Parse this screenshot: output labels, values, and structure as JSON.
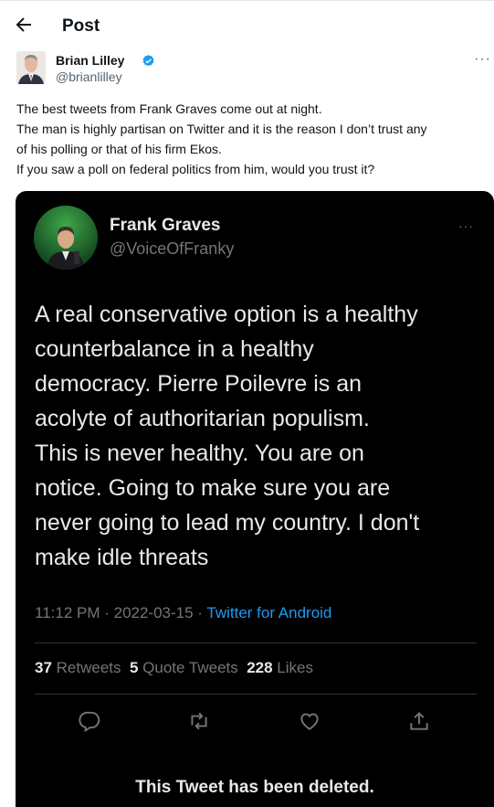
{
  "header": {
    "title": "Post",
    "back_icon": "back-arrow-icon"
  },
  "author": {
    "name": "Brian Lilley",
    "handle": "@brianlilley",
    "verified": true,
    "more_icon": "more-options-icon"
  },
  "post": {
    "lines": [
      "The best tweets from Frank Graves come out at night.",
      "The man is highly partisan on Twitter and it is the reason I don’t trust any",
      "of his polling or that of his firm Ekos.",
      "If you saw a poll on federal politics from him, would you trust it?"
    ]
  },
  "embedded_tweet": {
    "name": "Frank Graves",
    "handle": "@VoiceOfFranky",
    "lines": [
      "A real conservative option is a healthy",
      "counterbalance in a healthy",
      "democracy.  Pierre Poilevre is an",
      "acolyte of authoritarian populism.",
      "This is never healthy. You are on",
      "notice.  Going to make sure you are",
      "never going to lead my country. I don't",
      "make idle threats"
    ],
    "time": "11:12 PM · 2022-03-15 · ",
    "source": "Twitter for Android",
    "stats": {
      "retweets_count": "37",
      "retweets_label": " Retweets  ",
      "quotes_count": "5",
      "quotes_label": " Quote Tweets  ",
      "likes_count": "228",
      "likes_label": " Likes"
    },
    "actions": [
      "reply-icon",
      "retweet-icon",
      "like-icon",
      "share-icon"
    ],
    "deleted_notice": "This Tweet has been deleted."
  },
  "colors": {
    "accent": "#1d9bf0",
    "verified": "#1d9bf0",
    "text": "#0f1419",
    "muted": "#536471"
  }
}
